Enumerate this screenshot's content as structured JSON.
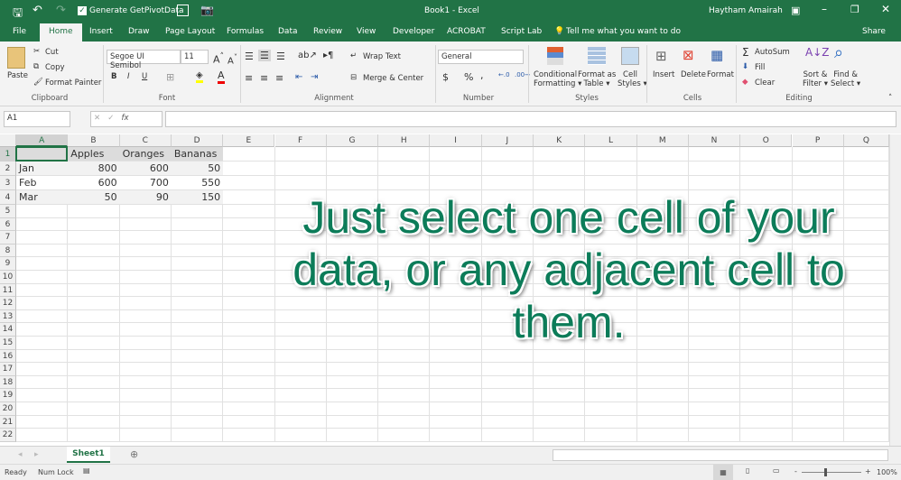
{
  "titlebar": {
    "qat_checkbox_label": "Generate GetPivotData",
    "title": "Book1 - Excel",
    "user": "Haytham Amairah"
  },
  "tabs": [
    "File",
    "Home",
    "Insert",
    "Draw",
    "Page Layout",
    "Formulas",
    "Data",
    "Review",
    "View",
    "Developer",
    "ACROBAT",
    "Script Lab"
  ],
  "tell_me": "Tell me what you want to do",
  "share": "Share",
  "ribbon": {
    "clipboard": {
      "paste": "Paste",
      "cut": "Cut",
      "copy": "Copy",
      "format_painter": "Format Painter",
      "label": "Clipboard"
    },
    "font": {
      "name": "Segoe UI Semibol",
      "size": "11",
      "bold": "B",
      "italic": "I",
      "underline": "U",
      "label": "Font"
    },
    "alignment": {
      "wrap": "Wrap Text",
      "merge": "Merge & Center",
      "label": "Alignment"
    },
    "number": {
      "format": "General",
      "currency": "$",
      "percent": "%",
      "comma": ",",
      "label": "Number"
    },
    "styles": {
      "conditional": "Conditional",
      "conditional2": "Formatting",
      "format_table": "Format as",
      "format_table2": "Table",
      "cell_styles": "Cell",
      "cell_styles2": "Styles",
      "label": "Styles"
    },
    "cells": {
      "insert": "Insert",
      "delete": "Delete",
      "format": "Format",
      "label": "Cells"
    },
    "editing": {
      "autosum": "AutoSum",
      "fill": "Fill",
      "clear": "Clear",
      "sort": "Sort &",
      "sort2": "Filter",
      "find": "Find &",
      "find2": "Select",
      "label": "Editing"
    }
  },
  "formula_bar": {
    "name_box": "A1",
    "formula": "",
    "fx": "fx"
  },
  "columns": [
    "A",
    "B",
    "C",
    "D",
    "E",
    "F",
    "G",
    "H",
    "I",
    "J",
    "K",
    "L",
    "M",
    "N",
    "O",
    "P",
    "Q"
  ],
  "rows": [
    "1",
    "2",
    "3",
    "4",
    "5",
    "6",
    "7",
    "8",
    "9",
    "10",
    "11",
    "12",
    "13",
    "14",
    "15",
    "16",
    "17",
    "18",
    "19",
    "20",
    "21",
    "22"
  ],
  "table": {
    "headers": [
      "",
      "Apples",
      "Oranges",
      "Bananas"
    ],
    "data": [
      [
        "Jan",
        "800",
        "600",
        "50"
      ],
      [
        "Feb",
        "600",
        "700",
        "550"
      ],
      [
        "Mar",
        "50",
        "90",
        "150"
      ]
    ]
  },
  "overlay": {
    "line1": "Just select one cell of your",
    "line2": "data, or any adjacent cell to",
    "line3": "them."
  },
  "sheets": [
    "Sheet1"
  ],
  "status": {
    "ready": "Ready",
    "numlock": "Num Lock",
    "zoom": "100%"
  },
  "colors": {
    "accent": "#217346",
    "overlay_text": "#0c7c59"
  }
}
